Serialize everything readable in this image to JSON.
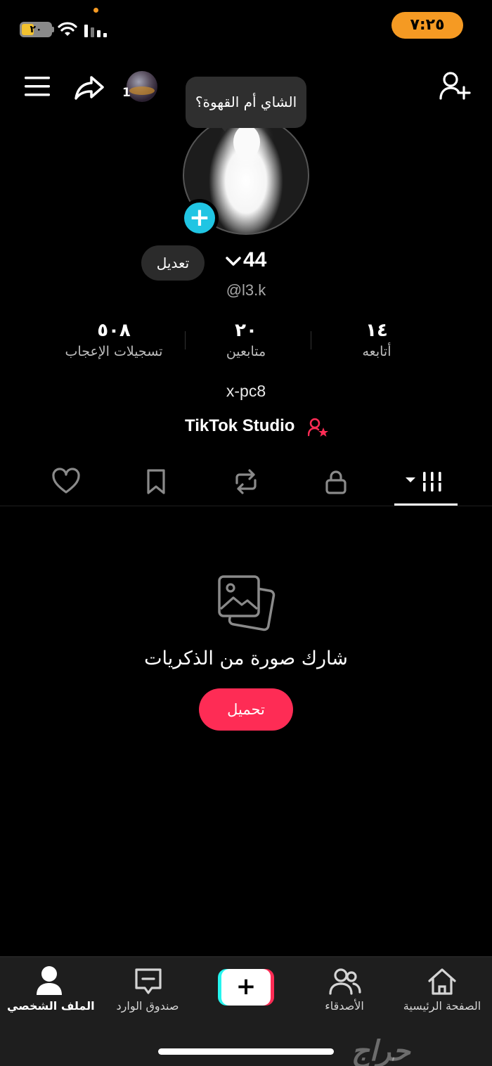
{
  "status_bar": {
    "battery": "٢٠",
    "time": "٧:٢٥",
    "icons": [
      "battery-icon",
      "wifi-icon",
      "signal-icon"
    ]
  },
  "header": {
    "icons": [
      "menu-icon",
      "share-icon",
      "add-user-icon"
    ],
    "story_count": "1"
  },
  "profile": {
    "tooltip": "الشاي أم القهوة؟",
    "name": "44",
    "username": "@l3.k",
    "edit_label": "تعديل",
    "bio": "x-pc8",
    "studio_label": "TikTok Studio",
    "stats": {
      "following": {
        "value": "١٤",
        "label": "أتابعه"
      },
      "followers": {
        "value": "٢٠",
        "label": "متابعين"
      },
      "likes": {
        "value": "٥٠٨",
        "label": "تسجيلات الإعجاب"
      }
    }
  },
  "tabs": [
    "videos-grid-icon",
    "lock-icon",
    "repost-icon",
    "bookmark-icon",
    "heart-icon"
  ],
  "empty_state": {
    "title": "شارك صورة من الذكريات",
    "upload_label": "تحميل"
  },
  "bottom_nav": {
    "home": "الصفحة الرئيسية",
    "friends": "الأصدقاء",
    "create": "+",
    "inbox": "صندوق الوارد",
    "profile": "الملف الشخصي"
  },
  "watermark": "حراج",
  "colors": {
    "accent": "#fe2c55",
    "badge": "#20c5e3",
    "clock_pill": "#f59a23",
    "background": "#000000"
  }
}
